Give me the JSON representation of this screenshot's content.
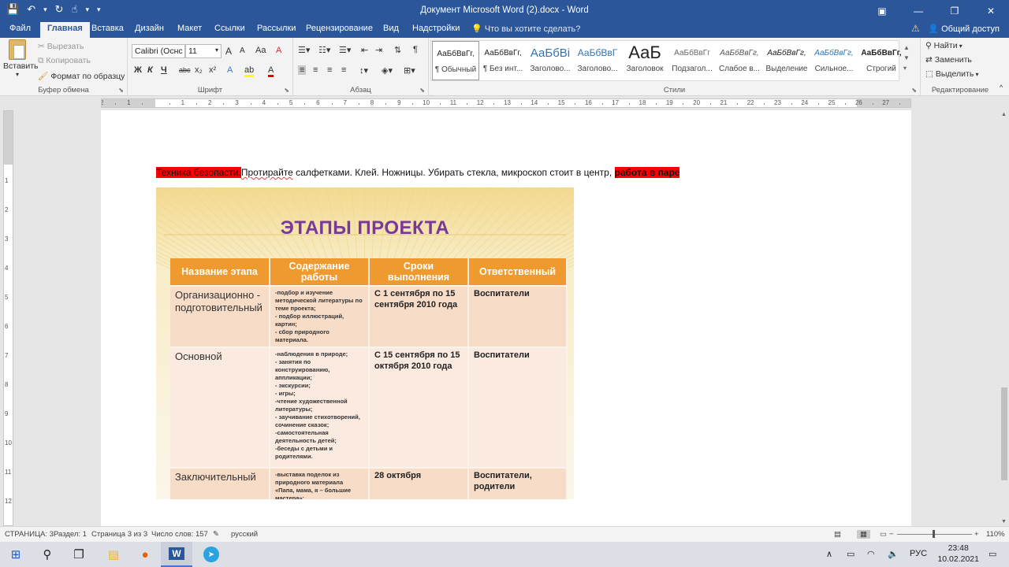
{
  "titlebar": {
    "title": "Документ Microsoft Word (2).docx  -  Word",
    "qat": {
      "save": "💾",
      "undo": "↶",
      "undo_dd": "▾",
      "redo": "↻",
      "touch": "☝",
      "touch_dd": "▾",
      "customize": "▾"
    },
    "win": {
      "ribbon_opts": "▣",
      "minimize": "—",
      "restore": "❐",
      "close": "✕"
    }
  },
  "tabs": [
    "Файл",
    "Главная",
    "Вставка",
    "Дизайн",
    "Макет",
    "Ссылки",
    "Рассылки",
    "Рецензирование",
    "Вид",
    "Надстройки"
  ],
  "tellme": "Что вы хотите сделать?",
  "share": "Общий доступ",
  "warn": "⚠",
  "ribbon": {
    "clipboard": {
      "paste": "Вставить",
      "cut": "Вырезать",
      "copy": "Копировать",
      "format_painter": "Формат по образцу",
      "label": "Буфер обмена"
    },
    "font": {
      "name": "Calibri (Оснс",
      "size": "11",
      "grow": "A",
      "shrink": "A",
      "case": "Aa",
      "clear": "A",
      "bold": "Ж",
      "italic": "К",
      "underline": "Ч",
      "strike": "abc",
      "sub": "x₂",
      "sup": "x²",
      "effects": "A",
      "highlight": "ab",
      "color": "A",
      "label": "Шрифт"
    },
    "paragraph": {
      "label": "Абзац"
    },
    "styles": {
      "label": "Стили",
      "items": [
        {
          "preview": "АаБбВвГг,",
          "name": "¶ Обычный"
        },
        {
          "preview": "АаБбВвГг,",
          "name": "¶ Без инт..."
        },
        {
          "preview": "АаБбВі",
          "name": "Заголово..."
        },
        {
          "preview": "АаБбВвГ",
          "name": "Заголово..."
        },
        {
          "preview": "АаБ",
          "name": "Заголовок"
        },
        {
          "preview": "АаБбВвГг",
          "name": "Подзагол..."
        },
        {
          "preview": "АаБбВвГг,",
          "name": "Слабое в..."
        },
        {
          "preview": "АаБбВвГг,",
          "name": "Выделение"
        },
        {
          "preview": "АаБбВвГг,",
          "name": "Сильное..."
        },
        {
          "preview": "АаБбВвГг,",
          "name": "Строгий"
        }
      ]
    },
    "editing": {
      "find": "Найти",
      "replace": "Заменить",
      "select": "Выделить",
      "label": "Редактирование"
    }
  },
  "ruler": {
    "h": [
      "2",
      "1",
      "",
      "1",
      "2",
      "3",
      "4",
      "5",
      "6",
      "7",
      "8",
      "9",
      "10",
      "11",
      "12",
      "13",
      "14",
      "15",
      "16",
      "17",
      "18",
      "19",
      "20",
      "21",
      "22",
      "23",
      "24",
      "25",
      "26",
      "27"
    ],
    "v": [
      "1",
      "2",
      "3",
      "4",
      "5",
      "6",
      "7",
      "8",
      "9",
      "10",
      "11",
      "12",
      "13"
    ],
    "corner": "L"
  },
  "document": {
    "line_hl1": "Техника безопасти.",
    "line_mid": "Протирайте",
    "line_rest": " салфетками. Клей. Ножницы. Убирать стекла, микроскоп стоит в центр,",
    "line_hl2": "работа в паре",
    "picture": {
      "title": "ЭТАПЫ ПРОЕКТА",
      "headers": [
        "Название этапа",
        "Содержание работы",
        "Сроки выполнения",
        "Ответственный"
      ],
      "rows": [
        {
          "stage": "Организационно - подготовительный",
          "content": "-подбор и  изучение методической литературы по теме проекта;\n- подбор иллюстраций, картин;\n- сбор природного материала.",
          "dates": "С 1 сентября по 15 сентября 2010 года",
          "resp": "Воспитатели"
        },
        {
          "stage": "Основной",
          "content": "-наблюдения в природе;\n- занятия по конструированию, аппликации;\n- экскурсии;\n- игры;\n-чтение художественной литературы;\n- заучивание стихотворений, сочинение сказок;\n-самостоятельная деятельность детей;\n-беседы с детьми и родителями.",
          "dates": "С 15 сентября по 15 октября 2010 года",
          "resp": "Воспитатели"
        },
        {
          "stage": "Заключительный",
          "content": "-выставка поделок из природного материала «Папа, мама, я – большие мастера»;",
          "dates": "28 октября",
          "resp": "Воспитатели, родители"
        }
      ]
    }
  },
  "status": {
    "page": "СТРАНИЦА: 3",
    "section": "Раздел: 1",
    "pages": "Страница 3 из 3",
    "words": "Число слов: 157",
    "lang": "русский",
    "zoom": "110%",
    "zoom_minus": "−",
    "zoom_plus": "+"
  },
  "taskbar": {
    "start": "⊞",
    "search": "⚲",
    "taskview": "❐",
    "explorer": "▤",
    "firefox": "●",
    "word": "W",
    "telegram": "➤",
    "chevron": "∧",
    "lang": "РУС",
    "time": "23:48",
    "date": "10.02.2021",
    "notif": "▭"
  }
}
